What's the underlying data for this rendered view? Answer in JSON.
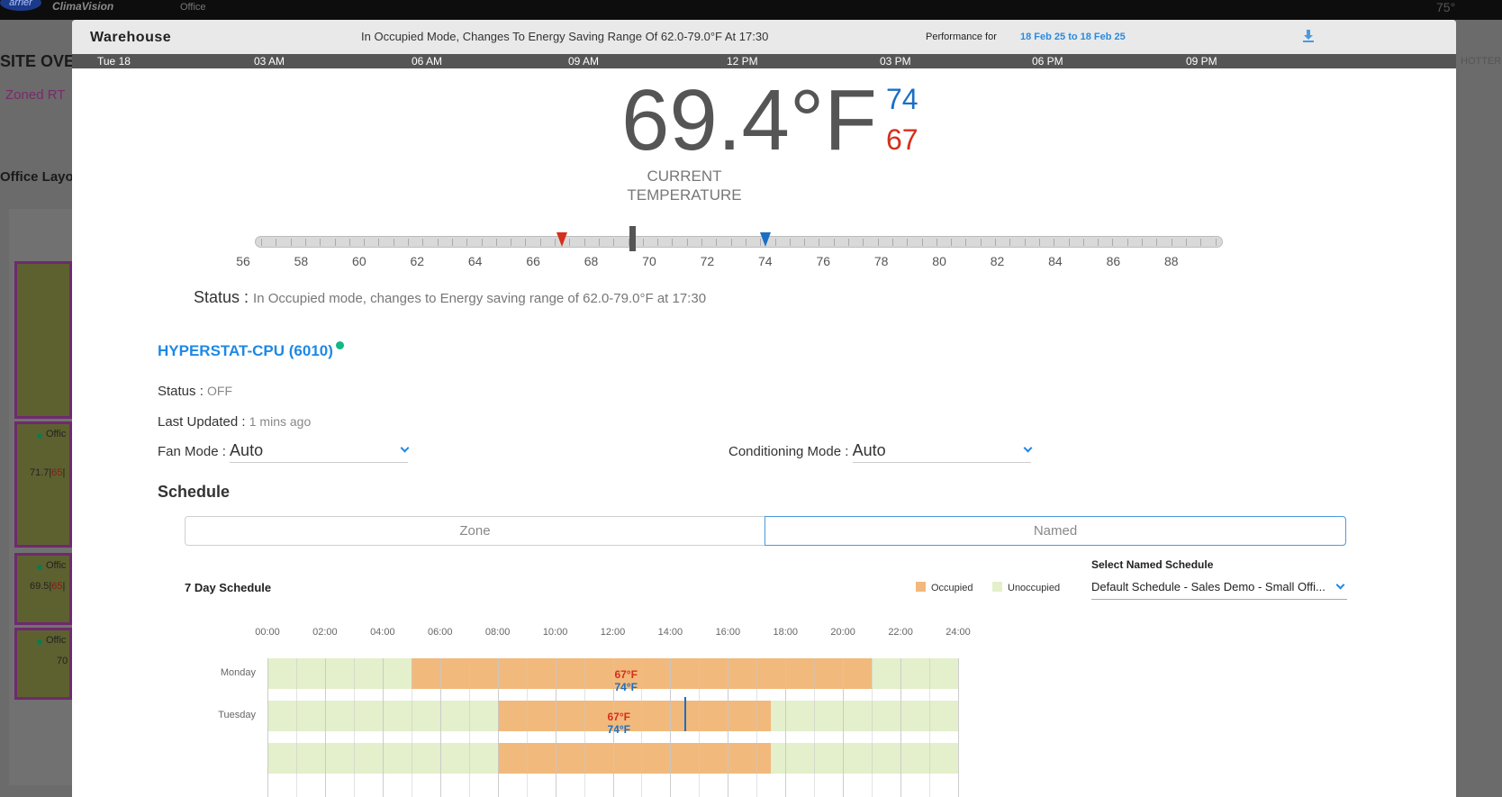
{
  "background": {
    "brand": "ClimaVision",
    "logo_text": "arrier",
    "office_label": "Office",
    "top_right_temp": "75°",
    "site_title": "SITE OVE",
    "zoned_label": "Zoned RT",
    "layout_label": "Office Layo",
    "hotter_label": "HOTTER",
    "cards": [
      {
        "name": "Offic",
        "vals_a": "71.7",
        "vals_b": "65"
      },
      {
        "name": "Offic",
        "vals_a": "69.5",
        "vals_b": "65"
      },
      {
        "name": "Offic",
        "vals_a": "70",
        "vals_b": ""
      }
    ]
  },
  "modal": {
    "title": "Warehouse",
    "header_status": "In Occupied Mode, Changes To Energy Saving Range Of 62.0-79.0°F At 17:30",
    "performance_label": "Performance for",
    "performance_range": "18 Feb 25 to 18 Feb 25",
    "timeline": [
      "Tue 18",
      "03 AM",
      "06 AM",
      "09 AM",
      "12 PM",
      "03 PM",
      "06 PM",
      "09 PM"
    ],
    "current_temp": "69.4°F",
    "cooling_setpoint": "74",
    "heating_setpoint": "67",
    "current_label_1": "CURRENT",
    "current_label_2": "TEMPERATURE",
    "scale": [
      "56",
      "58",
      "60",
      "62",
      "64",
      "66",
      "68",
      "70",
      "72",
      "74",
      "76",
      "78",
      "80",
      "82",
      "84",
      "86",
      "88"
    ],
    "slider": {
      "min": 56,
      "max": 89,
      "current": 69.4,
      "heating": 67,
      "cooling": 74
    },
    "status_label": "Status :",
    "status_text": "In Occupied mode, changes to Energy saving range of 62.0-79.0°F at 17:30",
    "device_name": "HYPERSTAT-CPU (6010)",
    "device_status_label": "Status :",
    "device_status_value": "OFF",
    "last_updated_label": "Last Updated :",
    "last_updated_value": "1 mins ago",
    "fan_mode_label": "Fan Mode :",
    "fan_mode_value": "Auto",
    "conditioning_mode_label": "Conditioning Mode :",
    "conditioning_mode_value": "Auto",
    "schedule_title": "Schedule",
    "tabs": [
      "Zone",
      "Named"
    ],
    "seven_day_label": "7 Day Schedule",
    "legend": [
      {
        "label": "Occupied",
        "color": "#f2b97c"
      },
      {
        "label": "Unoccupied",
        "color": "#e4efcc"
      }
    ],
    "select_schedule_label": "Select Named Schedule",
    "select_schedule_value": "Default Schedule - Sales Demo - Small Offi...",
    "hours": [
      "00:00",
      "02:00",
      "04:00",
      "06:00",
      "08:00",
      "10:00",
      "12:00",
      "14:00",
      "16:00",
      "18:00",
      "20:00",
      "22:00",
      "24:00"
    ],
    "days": [
      {
        "name": "Monday",
        "start": 5,
        "end": 21,
        "low": "67°F",
        "high": "74°F"
      },
      {
        "name": "Tuesday",
        "start": 8,
        "end": 17.5,
        "low": "67°F",
        "high": "74°F",
        "now": 14.5
      },
      {
        "name": "",
        "start": 8,
        "end": 17.5,
        "low": "",
        "high": ""
      }
    ]
  }
}
